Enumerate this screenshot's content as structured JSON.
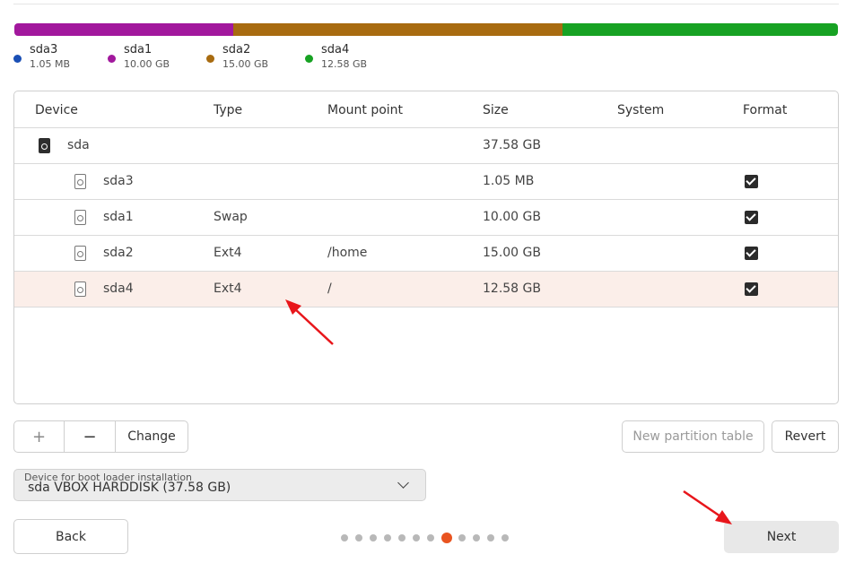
{
  "usage": {
    "segments": [
      {
        "name": "sda3",
        "gb": 0.001,
        "color": "#1a4fb5"
      },
      {
        "name": "sda1",
        "gb": 10.0,
        "color": "#a2189d"
      },
      {
        "name": "sda2",
        "gb": 15.0,
        "color": "#a86b10"
      },
      {
        "name": "sda4",
        "gb": 12.58,
        "color": "#17a223"
      }
    ],
    "legend": [
      {
        "name": "sda3",
        "size": "1.05 MB",
        "color": "#1a4fb5"
      },
      {
        "name": "sda1",
        "size": "10.00 GB",
        "color": "#a2189d"
      },
      {
        "name": "sda2",
        "size": "15.00 GB",
        "color": "#a86b10"
      },
      {
        "name": "sda4",
        "size": "12.58 GB",
        "color": "#17a223"
      }
    ]
  },
  "table": {
    "headers": {
      "device": "Device",
      "type": "Type",
      "mount": "Mount point",
      "size": "Size",
      "system": "System",
      "format": "Format"
    },
    "rows": [
      {
        "device": "sda",
        "type": "",
        "mount": "",
        "size": "37.58 GB",
        "format": null,
        "icon": "disk-drive-icon",
        "selected": false
      },
      {
        "device": "sda3",
        "type": "",
        "mount": "",
        "size": "1.05 MB",
        "format": true,
        "icon": "partition-icon",
        "selected": false
      },
      {
        "device": "sda1",
        "type": "Swap",
        "mount": "",
        "size": "10.00 GB",
        "format": true,
        "icon": "partition-icon",
        "selected": false
      },
      {
        "device": "sda2",
        "type": "Ext4",
        "mount": "/home",
        "size": "15.00 GB",
        "format": true,
        "icon": "partition-icon",
        "selected": false
      },
      {
        "device": "sda4",
        "type": "Ext4",
        "mount": "/",
        "size": "12.58 GB",
        "format": true,
        "icon": "partition-icon",
        "selected": true
      }
    ]
  },
  "toolbar": {
    "add_label": "+",
    "remove_label": "−",
    "change_label": "Change",
    "new_table_label": "New partition table",
    "revert_label": "Revert"
  },
  "boot": {
    "label": "Device for boot loader installation",
    "value": "sda VBOX HARDDISK (37.58 GB)"
  },
  "nav": {
    "back_label": "Back",
    "next_label": "Next",
    "total_steps": 12,
    "current_step": 8
  },
  "colors": {
    "accent": "#e95420",
    "arrow": "#e8161b",
    "selected_row": "#fbeee9"
  },
  "icons": {
    "dropdown": "chevron-down-icon",
    "checkbox": "checkbox-checked-icon",
    "annotation": "red-arrow-icon"
  }
}
